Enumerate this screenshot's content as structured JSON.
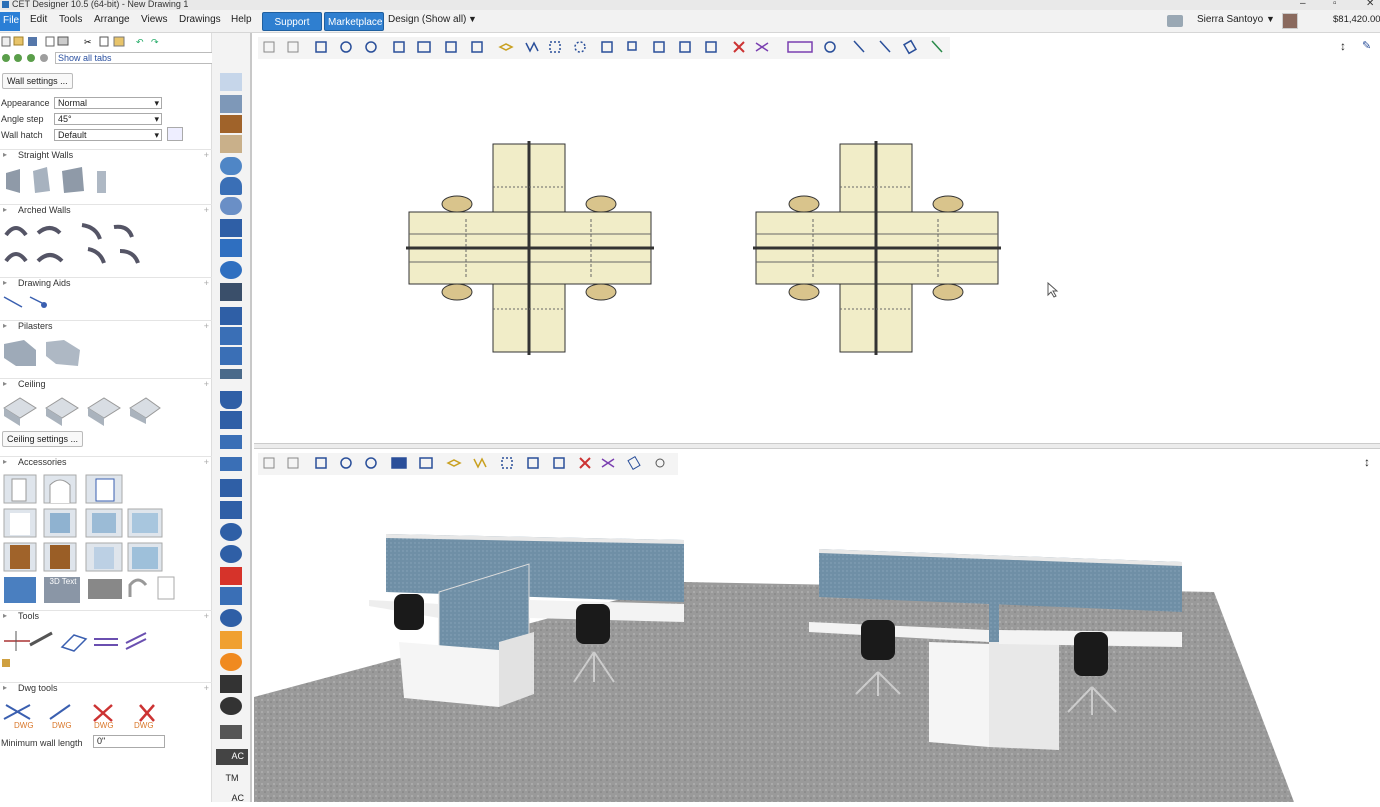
{
  "window": {
    "title": "CET Designer 10.5 (64-bit) - New Drawing 1"
  },
  "menu": {
    "items": [
      "File",
      "Edit",
      "Tools",
      "Arrange",
      "Views",
      "Drawings",
      "Help"
    ],
    "support": "Support",
    "marketplace": "Marketplace",
    "design_mode": "Design (Show all)",
    "user": "Sierra Santoyo",
    "price": "$81,420.00"
  },
  "toolbar": {
    "show_tabs": "Show all tabs"
  },
  "panel": {
    "wall_settings": "Wall settings ...",
    "appearance_label": "Appearance",
    "appearance_value": "Normal",
    "angle_label": "Angle step",
    "angle_value": "45°",
    "hatch_label": "Wall hatch",
    "hatch_value": "Default",
    "sections": [
      "Straight Walls",
      "Arched Walls",
      "Drawing Aids",
      "Pilasters",
      "Ceiling",
      "Accessories",
      "Tools",
      "Dwg tools"
    ],
    "ceiling_settings": "Ceiling settings ...",
    "text3d": "3D Text",
    "dwg": "DWG",
    "min_wall_label": "Minimum wall length",
    "min_wall_value": "0\"",
    "strip_labels": [
      "AC",
      "TM",
      "AC"
    ]
  },
  "colors": {
    "accent": "#2f7fd0",
    "desk": "#f1edc8",
    "panel_blue": "#6f8fa6",
    "floor": "#9a9a9a"
  }
}
